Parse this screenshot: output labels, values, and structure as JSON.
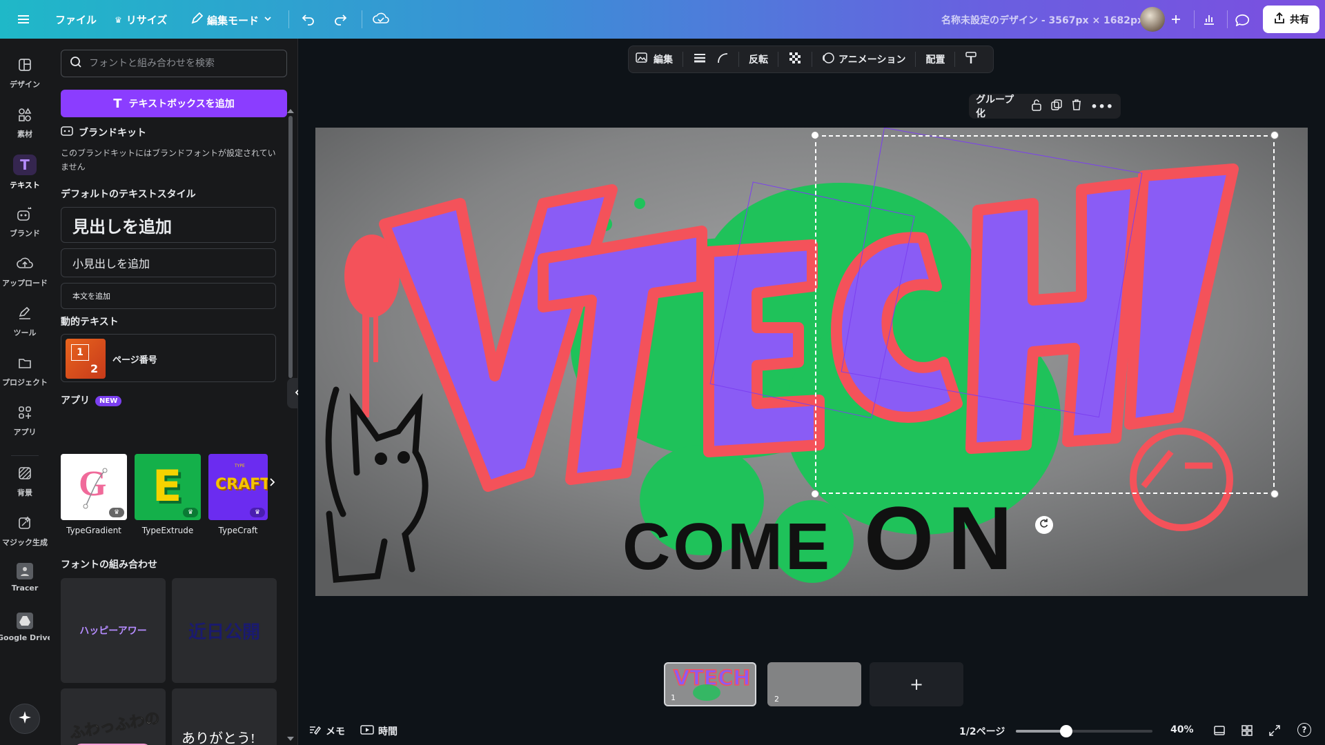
{
  "topbar": {
    "file_label": "ファイル",
    "resize_label": "リサイズ",
    "edit_mode_label": "編集モード",
    "doc_title": "名称未設定のデザイン - 3567px × 1682px",
    "share_label": "共有"
  },
  "rail": {
    "items": [
      {
        "label": "デザイン",
        "icon": "layout-icon"
      },
      {
        "label": "素材",
        "icon": "shapes-icon"
      },
      {
        "label": "テキスト",
        "icon": "text-icon"
      },
      {
        "label": "ブランド",
        "icon": "brand-icon"
      },
      {
        "label": "アップロード",
        "icon": "upload-icon"
      },
      {
        "label": "ツール",
        "icon": "pen-icon"
      },
      {
        "label": "プロジェクト",
        "icon": "folder-icon"
      },
      {
        "label": "アプリ",
        "icon": "apps-icon"
      },
      {
        "label": "背景",
        "icon": "pattern-icon"
      },
      {
        "label": "マジック生成",
        "icon": "magic-icon"
      },
      {
        "label": "Tracer",
        "icon": "tracer-icon"
      },
      {
        "label": "Google Drive",
        "icon": "drive-icon"
      }
    ]
  },
  "panel": {
    "search_placeholder": "フォントと組み合わせを検索",
    "add_textbox_label": "テキストボックスを追加",
    "brand_kit_title": "ブランドキット",
    "brand_kit_note": "このブランドキットにはブランドフォントが設定されていません",
    "default_styles_title": "デフォルトのテキストスタイル",
    "heading_label": "見出しを追加",
    "subheading_label": "小見出しを追加",
    "body_label": "本文を追加",
    "dynamic_text_title": "動的テキスト",
    "page_number_label": "ページ番号",
    "page_number_icon_top": "1",
    "page_number_icon_bottom": "2",
    "apps_title": "アプリ",
    "apps_badge": "NEW",
    "apps": [
      {
        "name": "TypeGradient",
        "glyph": "G"
      },
      {
        "name": "TypeExtrude",
        "glyph": "E"
      },
      {
        "name": "TypeCraft",
        "glyph": "CRAFT",
        "small_text": "TYPE"
      }
    ],
    "font_combos_title": "フォントの組み合わせ",
    "combos": [
      {
        "text": "ハッピーアワー"
      },
      {
        "text": "近日公開"
      },
      {
        "text": "ふわっふわの"
      },
      {
        "text": "ありがとう!"
      }
    ]
  },
  "toolbar": {
    "edit_label": "編集",
    "flip_label": "反転",
    "animation_label": "アニメーション",
    "arrange_label": "配置",
    "group_label": "グループ化"
  },
  "canvas": {
    "graffiti_main": "VTECH",
    "graffiti_sub_left": "COME",
    "graffiti_sub_right": "ON"
  },
  "pages": {
    "thumbs": [
      {
        "number": "1",
        "mini": "VTECH"
      },
      {
        "number": "2"
      }
    ],
    "add_label": "+"
  },
  "bottombar": {
    "notes_label": "メモ",
    "timer_label": "時間",
    "page_indicator": "1/2ページ",
    "zoom": "40%",
    "zoom_value": 0.4
  },
  "colors": {
    "accent": "#8b3dff",
    "graffiti_purple": "#8a5cf5",
    "graffiti_red": "#f4525a",
    "splash_green": "#1fc25a"
  }
}
